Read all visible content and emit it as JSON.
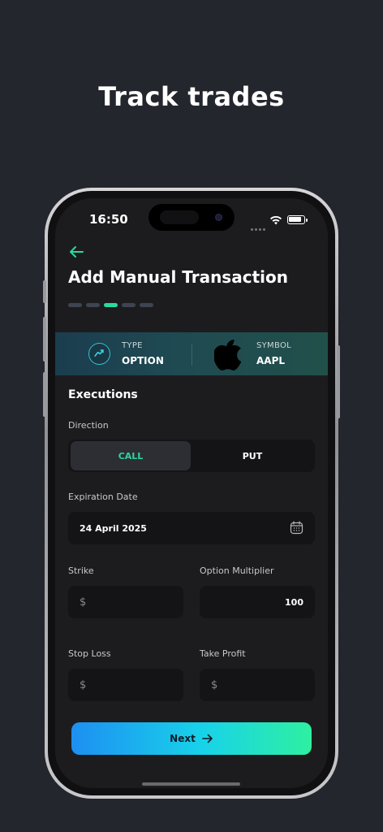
{
  "headline": "Track trades",
  "status_bar": {
    "time": "16:50"
  },
  "header": {
    "title": "Add Manual Transaction"
  },
  "stepper": {
    "total": 5,
    "active_index": 2
  },
  "summary": {
    "type_label": "TYPE",
    "type_value": "OPTION",
    "symbol_label": "SYMBOL",
    "symbol_value": "AAPL"
  },
  "executions": {
    "title": "Executions",
    "direction_label": "Direction",
    "direction_options": [
      "CALL",
      "PUT"
    ],
    "direction_selected": "CALL",
    "expiration_label": "Expiration Date",
    "expiration_value": "24 April 2025",
    "strike_label": "Strike",
    "strike_prefix": "$",
    "multiplier_label": "Option Multiplier",
    "multiplier_value": "100",
    "stop_loss_label": "Stop Loss",
    "stop_loss_prefix": "$",
    "take_profit_label": "Take Profit",
    "take_profit_prefix": "$"
  },
  "footer": {
    "next_label": "Next"
  },
  "colors": {
    "background": "#23262d",
    "screen": "#1c1c1e",
    "accent_green": "#29d9a0",
    "accent_blue": "#1d8ff2"
  },
  "icons": [
    "back-arrow-icon",
    "trend-chart-icon",
    "apple-logo-icon",
    "calendar-icon",
    "arrow-right-icon",
    "wifi-icon",
    "battery-icon"
  ]
}
